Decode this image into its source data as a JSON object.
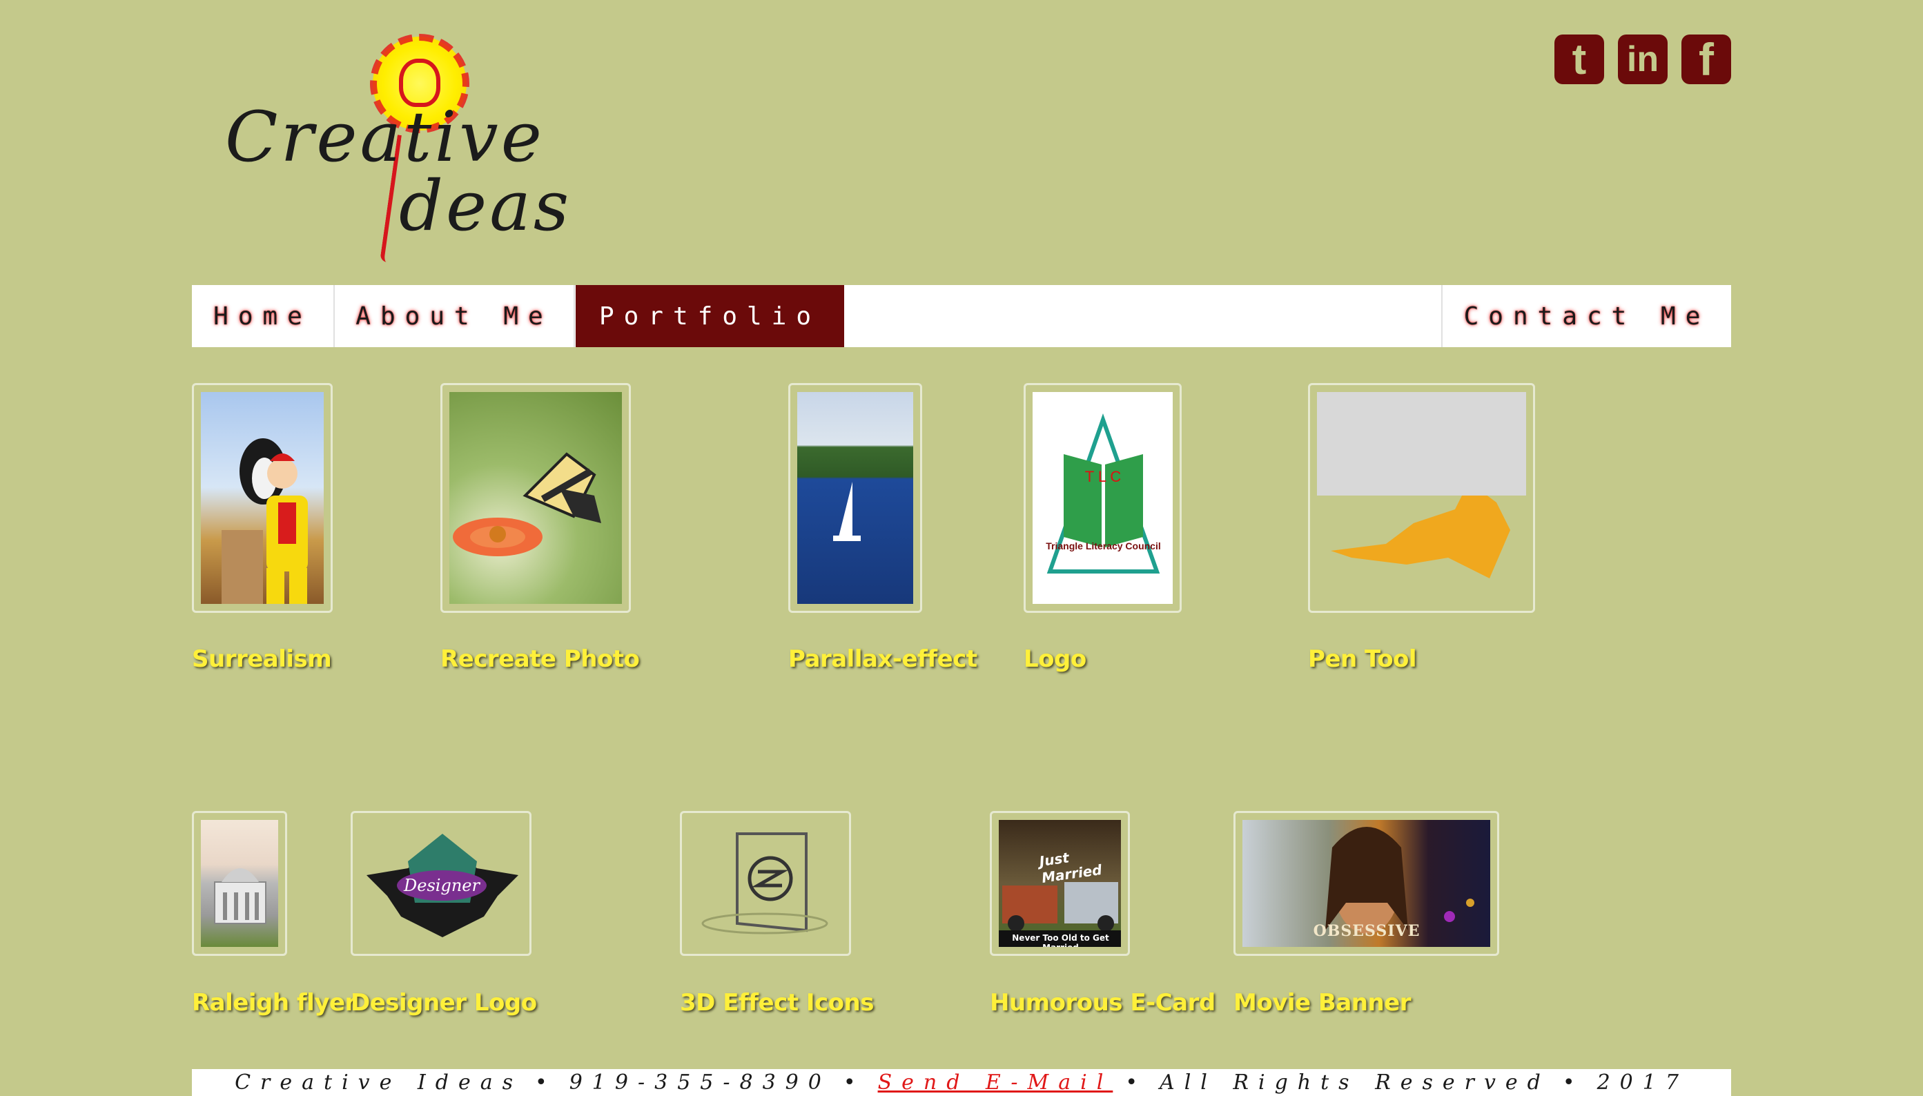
{
  "logo": {
    "word1": "Creative",
    "word2": "deas"
  },
  "social": [
    {
      "name": "tumblr",
      "glyph": "t"
    },
    {
      "name": "linkedin",
      "glyph": "in"
    },
    {
      "name": "facebook",
      "glyph": "f"
    }
  ],
  "nav": {
    "home": "Home",
    "about": "About Me",
    "portfolio": "Portfolio",
    "contact": "Contact Me"
  },
  "gallery": {
    "row1": [
      {
        "caption": "Surrealism"
      },
      {
        "caption": "Recreate Photo"
      },
      {
        "caption": "Parallax-effect"
      },
      {
        "caption": "Logo",
        "logo_text": "T L C",
        "logo_sub": "Triangle Literacy Council"
      },
      {
        "caption": "Pen Tool"
      }
    ],
    "row2": [
      {
        "caption": "Raleigh flyer"
      },
      {
        "caption": "Designer Logo",
        "badge_text": "Designer"
      },
      {
        "caption": "3D Effect Icons"
      },
      {
        "caption": "Humorous E-Card",
        "card_top": "Just Married",
        "card_bottom": "Never Too Old to Get Married"
      },
      {
        "caption": "Movie Banner",
        "banner_text": "OBSESSIVE"
      }
    ]
  },
  "footer": {
    "name": "Creative Ideas",
    "phone": "919-355-8390",
    "email_link": "Send E-Mail",
    "rights": "All Rights Reserved",
    "year": "2017",
    "separator": "•"
  },
  "colors": {
    "background": "#c4c98b",
    "accent": "#6b0a0a",
    "caption": "#fff03a"
  }
}
